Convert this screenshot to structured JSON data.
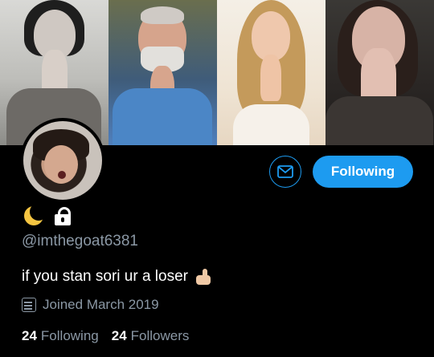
{
  "profile": {
    "status_emoji": "moon-icon",
    "protected_icon": "lock-icon",
    "handle": "@imthegoat6381",
    "bio": "if you stan sori ur a loser",
    "bio_emoji": "thumbs-up-icon",
    "joined": "Joined March 2019",
    "following_count": "24",
    "following_label": "Following",
    "followers_count": "24",
    "followers_label": "Followers"
  },
  "actions": {
    "message_icon": "envelope-icon",
    "follow_label": "Following"
  },
  "colors": {
    "accent": "#1d9bf0",
    "secondary_text": "#8b98a5",
    "background": "#000000"
  }
}
